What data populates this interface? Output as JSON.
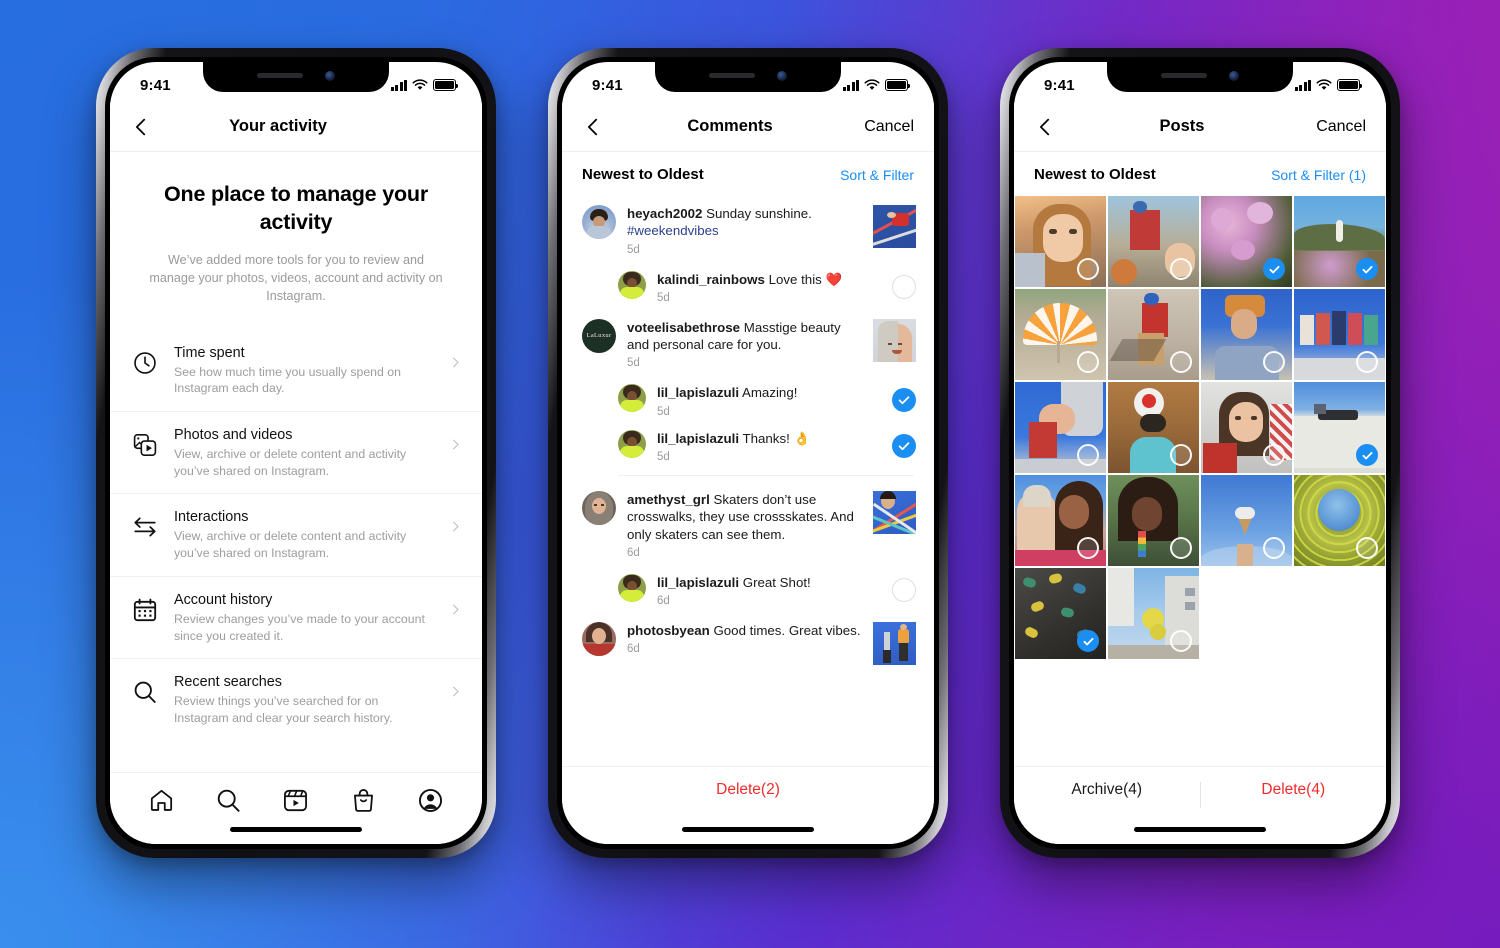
{
  "background": {
    "from": "#2b6fe0",
    "to": "#a01fae",
    "accent_blue": "#1b8ef2",
    "accent_red": "#f12c2c"
  },
  "status_bar": {
    "time": "9:41",
    "signal": "cellular-bars-icon",
    "wifi": "wifi-icon",
    "battery": "battery-full-icon"
  },
  "phone1": {
    "nav": {
      "back": "chevron-left-icon",
      "title": "Your activity"
    },
    "hero": {
      "title": "One place to manage your activity",
      "subtitle": "We’ve added more tools for you to review and manage your photos, videos, account and activity on Instagram."
    },
    "rows": [
      {
        "icon": "clock-icon",
        "title": "Time spent",
        "sub": "See how much time you usually spend on Instagram each day."
      },
      {
        "icon": "photos-videos-icon",
        "title": "Photos and videos",
        "sub": "View, archive or delete content and activity you’ve shared on Instagram."
      },
      {
        "icon": "interactions-arrows-icon",
        "title": "Interactions",
        "sub": "View, archive or delete content and activity you’ve shared on Instagram."
      },
      {
        "icon": "calendar-icon",
        "title": "Account history",
        "sub": "Review changes you’ve made to your account since you created it."
      },
      {
        "icon": "search-icon",
        "title": "Recent searches",
        "sub": "Review things you’ve searched for on Instagram and clear your search history."
      }
    ],
    "tabbar": [
      "home-icon",
      "search-icon",
      "reels-icon",
      "shop-bag-icon",
      "profile-avatar-icon"
    ]
  },
  "phone2": {
    "nav": {
      "back": "chevron-left-icon",
      "title": "Comments",
      "right": "Cancel"
    },
    "sort": {
      "label": "Newest to Oldest",
      "action": "Sort & Filter"
    },
    "comments": [
      {
        "user": "heyach2002",
        "text": " Sunday sunshine. ",
        "tag": "#weekendvibes",
        "time": "5d",
        "reply": false,
        "thumb": "pole-vault-red-photo",
        "selector": "none"
      },
      {
        "user": "kalindi_rainbows",
        "text": " Love this ❤️",
        "time": "5d",
        "reply": true,
        "thumb": "none",
        "selector": "off"
      },
      {
        "user": "voteelisabethrose",
        "text": " Masstige beauty and personal care for you.",
        "time": "5d",
        "reply": false,
        "thumb": "woman-skincare-photo",
        "selector": "none"
      },
      {
        "user": "lil_lapislazuli",
        "text": " Amazing!",
        "time": "5d",
        "reply": true,
        "thumb": "none",
        "selector": "on"
      },
      {
        "user": "lil_lapislazuli",
        "text": " Thanks! 👌",
        "time": "5d",
        "reply": true,
        "thumb": "none",
        "selector": "on"
      },
      {
        "user": "amethyst_grl",
        "text": " Skaters don’t use crosswalks, they use crossskates. And only skaters can see them.",
        "time": "6d",
        "reply": false,
        "thumb": "skater-ribbons-photo",
        "selector": "none"
      },
      {
        "user": "lil_lapislazuli",
        "text": " Great Shot!",
        "time": "6d",
        "reply": true,
        "thumb": "none",
        "selector": "off"
      },
      {
        "user": "photosbyean",
        "text": " Good times. Great vibes.",
        "time": "6d",
        "reply": false,
        "thumb": "two-people-blue-photo",
        "selector": "none"
      }
    ],
    "footer": {
      "delete_label": "Delete(2)"
    }
  },
  "phone3": {
    "nav": {
      "back": "chevron-left-icon",
      "title": "Posts",
      "right": "Cancel"
    },
    "sort": {
      "label": "Newest to Oldest",
      "action": "Sort & Filter (1)"
    },
    "grid": [
      {
        "name": "selfie-sunset-girl",
        "selected": false
      },
      {
        "name": "friends-mountain-jump",
        "selected": false
      },
      {
        "name": "pink-blossom-flowers",
        "selected": true
      },
      {
        "name": "hillside-heather-path",
        "selected": true
      },
      {
        "name": "orange-striped-umbrella",
        "selected": false
      },
      {
        "name": "dancer-blue-beanie",
        "selected": false
      },
      {
        "name": "woman-hands-over-head",
        "selected": false
      },
      {
        "name": "group-friends-on-wall",
        "selected": false
      },
      {
        "name": "hand-on-statue-blue-sky",
        "selected": false
      },
      {
        "name": "balancing-ball-cliff",
        "selected": false
      },
      {
        "name": "smiling-woman-red-top",
        "selected": false
      },
      {
        "name": "white-building-skater",
        "selected": true
      },
      {
        "name": "couple-embrace",
        "selected": false
      },
      {
        "name": "rainbow-earring-profile",
        "selected": false
      },
      {
        "name": "ice-cream-cone-sky",
        "selected": false
      },
      {
        "name": "yellow-spiral-structure",
        "selected": false
      },
      {
        "name": "climbing-wall-holds",
        "selected": true
      },
      {
        "name": "yellow-balloons-building",
        "selected": false
      }
    ],
    "footer": {
      "archive_label": "Archive(4)",
      "delete_label": "Delete(4)"
    }
  }
}
